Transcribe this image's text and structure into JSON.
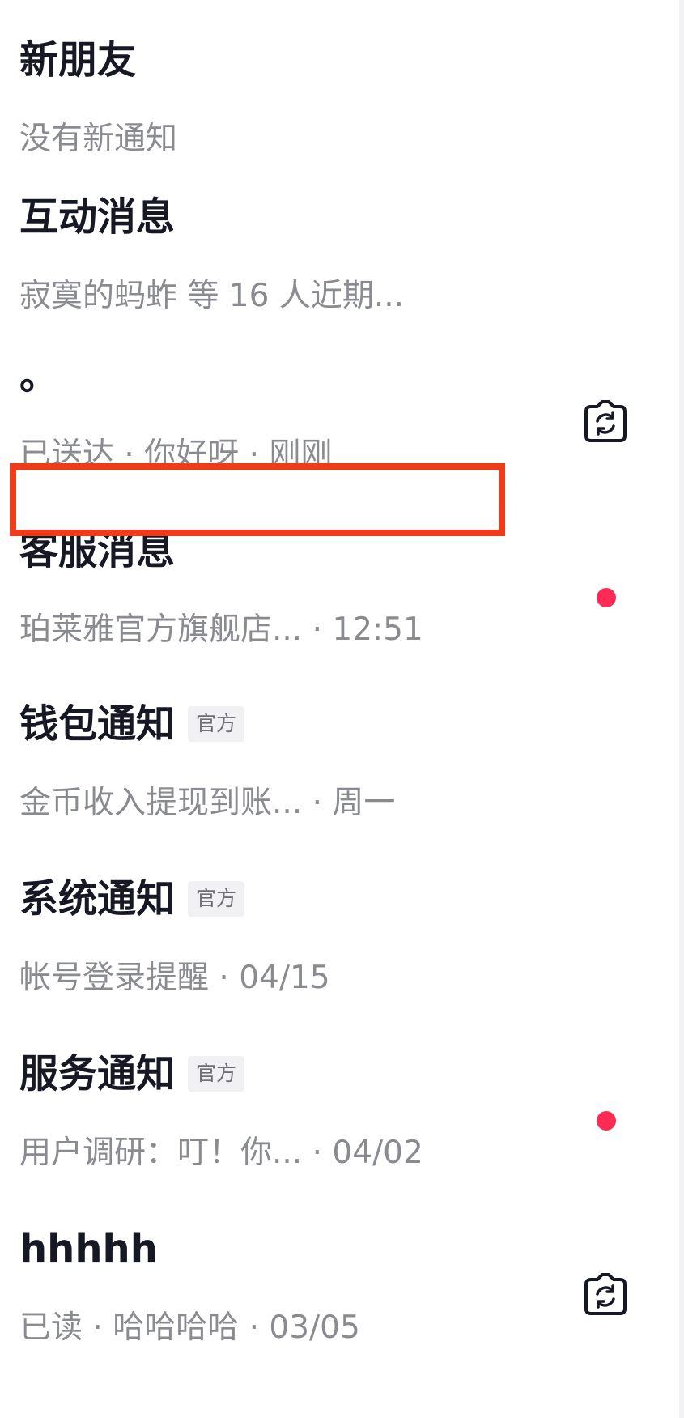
{
  "rows": [
    {
      "title": "新朋友",
      "subtitle": "没有新通知"
    },
    {
      "title": "互动消息",
      "subtitle": "寂寞的蚂蚱 等 16 人近期..."
    },
    {
      "title": "。",
      "subtitle": "已送达 · 你好呀 · 刚刚",
      "icon": "sync-camera-icon"
    },
    {
      "title": "客服消息",
      "subtitle": "珀莱雅官方旗舰店... · 12:51",
      "unread": true
    },
    {
      "title": "钱包通知",
      "badge": "官方",
      "subtitle": "金币收入提现到账... · 周一"
    },
    {
      "title": "系统通知",
      "badge": "官方",
      "subtitle": "帐号登录提醒 · 04/15"
    },
    {
      "title": "服务通知",
      "badge": "官方",
      "subtitle": "用户调研：叮！你... · 04/02",
      "unread": true
    },
    {
      "title": "hhhhh",
      "subtitle": "已读 · 哈哈哈哈 · 03/05",
      "icon": "sync-camera-icon"
    }
  ],
  "colors": {
    "title": "#161823",
    "subtitle": "#8a8b91",
    "unread_dot": "#fe2c55",
    "highlight_box": "#f13a17",
    "badge_bg": "#f1f1f3"
  }
}
